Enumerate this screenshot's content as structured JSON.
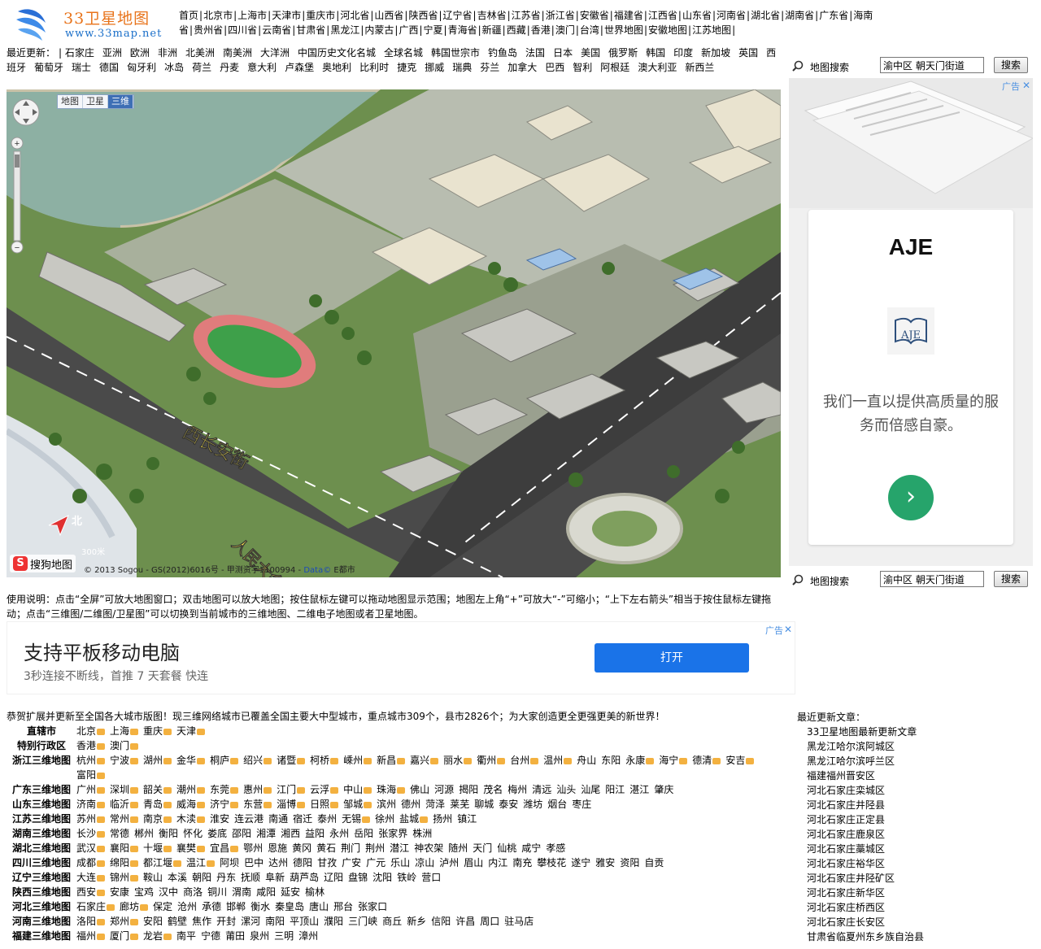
{
  "site": {
    "logo_title": "33卫星地图",
    "logo_url": "www.33map.net"
  },
  "topnav": [
    "首页",
    "北京市",
    "上海市",
    "天津市",
    "重庆市",
    "河北省",
    "山西省",
    "陕西省",
    "辽宁省",
    "吉林省",
    "江苏省",
    "浙江省",
    "安徽省",
    "福建省",
    "江西省",
    "山东省",
    "河南省",
    "湖北省",
    "湖南省",
    "广东省",
    "海南省",
    "贵州省",
    "四川省",
    "云南省",
    "甘肃省",
    "黑龙江",
    "内蒙古",
    "广西",
    "宁夏",
    "青海省",
    "新疆",
    "西藏",
    "香港",
    "澳门",
    "台湾",
    "世界地图",
    "安徽地图",
    "江苏地图"
  ],
  "recent": {
    "label": "最近更新：",
    "items": [
      "石家庄",
      "亚洲",
      "欧洲",
      "非洲",
      "北美洲",
      "南美洲",
      "大洋洲",
      "中国历史文化名城",
      "全球名城",
      "韩国世宗市",
      "钓鱼岛",
      "法国",
      "日本",
      "美国",
      "俄罗斯",
      "韩国",
      "印度",
      "新加坡",
      "英国",
      "西班牙",
      "葡萄牙",
      "瑞士",
      "德国",
      "匈牙利",
      "冰岛",
      "荷兰",
      "丹麦",
      "意大利",
      "卢森堡",
      "奥地利",
      "比利时",
      "捷克",
      "挪威",
      "瑞典",
      "芬兰",
      "加拿大",
      "巴西",
      "智利",
      "阿根廷",
      "澳大利亚",
      "新西兰"
    ]
  },
  "map": {
    "tabs": [
      "地图",
      "卫星",
      "三维"
    ],
    "active_tab": "三维",
    "road_label": "西长安街",
    "road_label2": "人民大会",
    "north_label": "北",
    "scale_label": "300米",
    "brand": "搜狗地图",
    "copyright_prefix": "© 2013 Sogou - GS(2012)6016号 - 甲测资字1100994 -",
    "copyright_link": "Data©",
    "copyright_suffix": "E都市"
  },
  "search": {
    "label": "地图搜索",
    "value": "渝中区 朝天门街道",
    "button": "搜索"
  },
  "ad_right": {
    "tag": "广告",
    "close": "✕",
    "brand": "AJE",
    "emblem_text": "AJE",
    "message": "我们一直以提供高质量的服务而倍感自豪。",
    "go": "›"
  },
  "usage": "使用说明：点击“全屏”可放大地图窗口；双击地图可以放大地图；按住鼠标左键可以拖动地图显示范围；地图左上角“+”可放大“-”可缩小；“上下左右箭头”相当于按住鼠标左键拖动；点击“三维图/二维图/卫星图”可以切换到当前城市的三维地图、二维电子地图或者卫星地图。",
  "ad_mid": {
    "tag": "广告",
    "close": "✕",
    "headline": "支持平板移动电脑",
    "sub": "3秒连接不断线，首推 7 天套餐 快连",
    "button": "打开"
  },
  "intro": "恭贺扩展并更新至全国各大城市版图！现三维网络城市已覆盖全国主要大中型城市，重点城市309个，县市2826个；为大家创造更全更强更美的新世界！",
  "city_rows": [
    {
      "label": "直辖市",
      "cities": [
        "北京",
        "上海",
        "重庆",
        "天津"
      ],
      "hot": [
        1,
        1,
        1,
        1
      ]
    },
    {
      "label": "特别行政区",
      "cities": [
        "香港",
        "澳门"
      ],
      "hot": [
        1,
        1
      ]
    },
    {
      "label": "浙江三维地图",
      "cities": [
        "杭州",
        "宁波",
        "湖州",
        "金华",
        "桐庐",
        "绍兴",
        "诸暨",
        "柯桥",
        "嵊州",
        "新昌",
        "嘉兴",
        "丽水",
        "衢州",
        "台州",
        "温州",
        "舟山",
        "东阳",
        "永康",
        "海宁",
        "德清",
        "安吉",
        "富阳"
      ],
      "hot": [
        1,
        1,
        1,
        1,
        1,
        1,
        1,
        1,
        1,
        1,
        1,
        1,
        1,
        1,
        1,
        0,
        0,
        1,
        1,
        1,
        1,
        1
      ]
    },
    {
      "label": "广东三维地图",
      "cities": [
        "广州",
        "深圳",
        "韶关",
        "潮州",
        "东莞",
        "惠州",
        "江门",
        "云浮",
        "中山",
        "珠海",
        "佛山",
        "河源",
        "揭阳",
        "茂名",
        "梅州",
        "清远",
        "汕头",
        "汕尾",
        "阳江",
        "湛江",
        "肇庆"
      ],
      "hot": [
        1,
        1,
        1,
        1,
        1,
        1,
        1,
        1,
        1,
        1,
        0,
        0,
        0,
        0,
        0,
        0,
        0,
        0,
        0,
        0,
        0
      ]
    },
    {
      "label": "山东三维地图",
      "cities": [
        "济南",
        "临沂",
        "青岛",
        "威海",
        "济宁",
        "东营",
        "淄博",
        "日照",
        "邹城",
        "滨州",
        "德州",
        "菏泽",
        "莱芜",
        "聊城",
        "泰安",
        "潍坊",
        "烟台",
        "枣庄"
      ],
      "hot": [
        1,
        1,
        1,
        1,
        1,
        1,
        1,
        1,
        1,
        0,
        0,
        0,
        0,
        0,
        0,
        0,
        0,
        0
      ]
    },
    {
      "label": "江苏三维地图",
      "cities": [
        "苏州",
        "常州",
        "南京",
        "木渎",
        "淮安",
        "连云港",
        "南通",
        "宿迁",
        "泰州",
        "无锡",
        "徐州",
        "盐城",
        "扬州",
        "镇江"
      ],
      "hot": [
        1,
        1,
        1,
        1,
        0,
        0,
        0,
        0,
        0,
        1,
        0,
        1,
        0,
        0
      ]
    },
    {
      "label": "湖南三维地图",
      "cities": [
        "长沙",
        "常德",
        "郴州",
        "衡阳",
        "怀化",
        "娄底",
        "邵阳",
        "湘潭",
        "湘西",
        "益阳",
        "永州",
        "岳阳",
        "张家界",
        "株洲"
      ],
      "hot": [
        1,
        0,
        0,
        0,
        0,
        0,
        0,
        0,
        0,
        0,
        0,
        0,
        0,
        0
      ]
    },
    {
      "label": "湖北三维地图",
      "cities": [
        "武汉",
        "襄阳",
        "十堰",
        "襄樊",
        "宜昌",
        "鄂州",
        "恩施",
        "黄冈",
        "黄石",
        "荆门",
        "荆州",
        "潜江",
        "神农架",
        "随州",
        "天门",
        "仙桃",
        "咸宁",
        "孝感"
      ],
      "hot": [
        1,
        1,
        1,
        1,
        1,
        0,
        0,
        0,
        0,
        0,
        0,
        0,
        0,
        0,
        0,
        0,
        0,
        0
      ]
    },
    {
      "label": "四川三维地图",
      "cities": [
        "成都",
        "绵阳",
        "都江堰",
        "温江",
        "阿坝",
        "巴中",
        "达州",
        "德阳",
        "甘孜",
        "广安",
        "广元",
        "乐山",
        "凉山",
        "泸州",
        "眉山",
        "内江",
        "南充",
        "攀枝花",
        "遂宁",
        "雅安",
        "资阳",
        "自贡"
      ],
      "hot": [
        1,
        1,
        1,
        1,
        0,
        0,
        0,
        0,
        0,
        0,
        0,
        0,
        0,
        0,
        0,
        0,
        0,
        0,
        0,
        0,
        0,
        0
      ]
    },
    {
      "label": "辽宁三维地图",
      "cities": [
        "大连",
        "锦州",
        "鞍山",
        "本溪",
        "朝阳",
        "丹东",
        "抚顺",
        "阜新",
        "葫芦岛",
        "辽阳",
        "盘锦",
        "沈阳",
        "铁岭",
        "营口"
      ],
      "hot": [
        1,
        1,
        0,
        0,
        0,
        0,
        0,
        0,
        0,
        0,
        0,
        0,
        0,
        0
      ]
    },
    {
      "label": "陕西三维地图",
      "cities": [
        "西安",
        "安康",
        "宝鸡",
        "汉中",
        "商洛",
        "铜川",
        "渭南",
        "咸阳",
        "延安",
        "榆林"
      ],
      "hot": [
        1,
        0,
        0,
        0,
        0,
        0,
        0,
        0,
        0,
        0
      ]
    },
    {
      "label": "河北三维地图",
      "cities": [
        "石家庄",
        "廊坊",
        "保定",
        "沧州",
        "承德",
        "邯郸",
        "衡水",
        "秦皇岛",
        "唐山",
        "邢台",
        "张家口"
      ],
      "hot": [
        1,
        1,
        0,
        0,
        0,
        0,
        0,
        0,
        0,
        0,
        0
      ]
    },
    {
      "label": "河南三维地图",
      "cities": [
        "洛阳",
        "郑州",
        "安阳",
        "鹤壁",
        "焦作",
        "开封",
        "漯河",
        "南阳",
        "平顶山",
        "濮阳",
        "三门峡",
        "商丘",
        "新乡",
        "信阳",
        "许昌",
        "周口",
        "驻马店"
      ],
      "hot": [
        1,
        1,
        0,
        0,
        0,
        0,
        0,
        0,
        0,
        0,
        0,
        0,
        0,
        0,
        0,
        0,
        0
      ]
    },
    {
      "label": "福建三维地图",
      "cities": [
        "福州",
        "厦门",
        "龙岩",
        "南平",
        "宁德",
        "莆田",
        "泉州",
        "三明",
        "漳州"
      ],
      "hot": [
        1,
        1,
        1,
        0,
        0,
        0,
        0,
        0,
        0
      ]
    }
  ],
  "articles": {
    "heading": "最近更新文章：",
    "items": [
      "33卫星地图最新更新文章",
      "黑龙江哈尔滨阿城区",
      "黑龙江哈尔滨呼兰区",
      "福建福州晋安区",
      "河北石家庄栾城区",
      "河北石家庄井陉县",
      "河北石家庄正定县",
      "河北石家庄鹿泉区",
      "河北石家庄藁城区",
      "河北石家庄裕华区",
      "河北石家庄井陉矿区",
      "河北石家庄新华区",
      "河北石家庄桥西区",
      "河北石家庄长安区",
      "甘肃省临夏州东乡族自治县"
    ]
  }
}
